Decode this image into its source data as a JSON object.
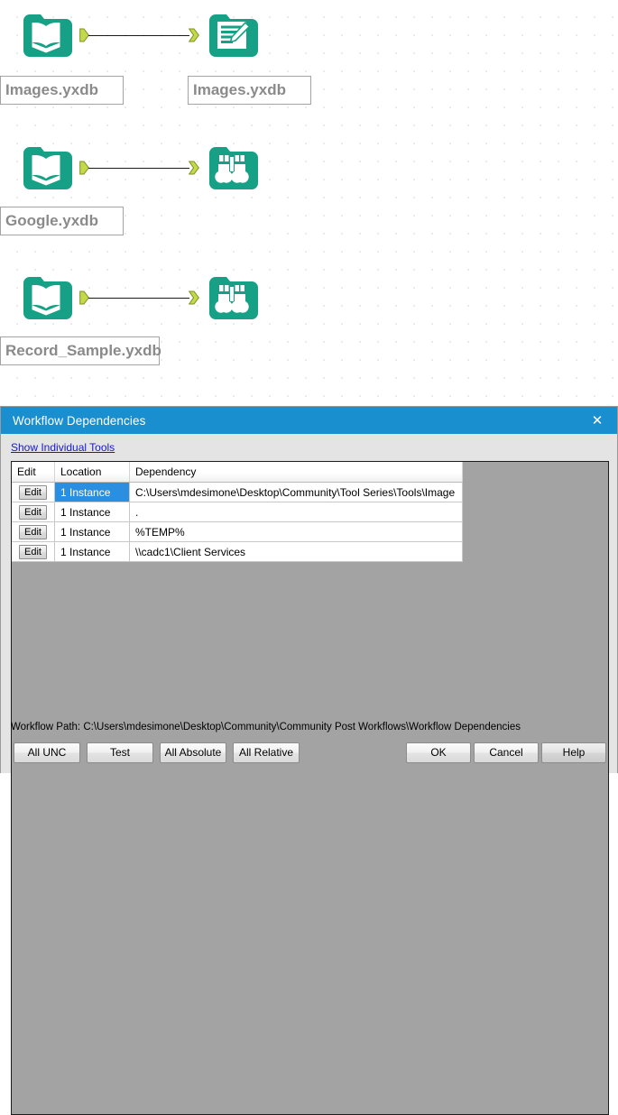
{
  "canvas": {
    "tools": [
      {
        "id": "input-images",
        "icon": "input-data-icon",
        "label": "Images.yxdb"
      },
      {
        "id": "output-images",
        "icon": "output-data-icon",
        "label": "Images.yxdb"
      },
      {
        "id": "input-google",
        "icon": "input-data-icon",
        "label": "Google.yxdb"
      },
      {
        "id": "browse-google",
        "icon": "browse-icon",
        "label": ""
      },
      {
        "id": "input-record",
        "icon": "input-data-icon",
        "label": "Record_Sample.yxdb"
      },
      {
        "id": "browse-record",
        "icon": "browse-icon",
        "label": ""
      }
    ],
    "colors": {
      "tool_teal": "#16a085",
      "anchor_green": "#c3d84a",
      "grid_dot": "#b8b8b8",
      "label_text": "#8a8a8a"
    }
  },
  "dialog": {
    "title": "Workflow Dependencies",
    "close_label": "✕",
    "show_individual_tools_link": "Show Individual Tools",
    "table": {
      "columns": [
        "Edit",
        "Location",
        "Dependency"
      ],
      "rows": [
        {
          "edit": "Edit",
          "location": "1 Instance",
          "dependency": "C:\\Users\\mdesimone\\Desktop\\Community\\Tool Series\\Tools\\Image",
          "selected": true
        },
        {
          "edit": "Edit",
          "location": "1 Instance",
          "dependency": ".",
          "selected": false
        },
        {
          "edit": "Edit",
          "location": "1 Instance",
          "dependency": "%TEMP%",
          "selected": false
        },
        {
          "edit": "Edit",
          "location": "1 Instance",
          "dependency": "\\\\cadc1\\Client Services",
          "selected": false
        }
      ]
    },
    "workflow_path": "Workflow Path: C:\\Users\\mdesimone\\Desktop\\Community\\Community Post Workflows\\Workflow Dependencies",
    "buttons": {
      "all_unc": "All UNC",
      "test": "Test",
      "all_absolute": "All Absolute",
      "all_relative": "All Relative",
      "ok": "OK",
      "cancel": "Cancel",
      "help": "Help"
    },
    "colors": {
      "titlebar": "#1a8fd0",
      "dialog_bg": "#e4e4e4",
      "grid_bg": "#a3a3a3",
      "selection": "#2a8fe0",
      "link": "#1818c8"
    }
  }
}
